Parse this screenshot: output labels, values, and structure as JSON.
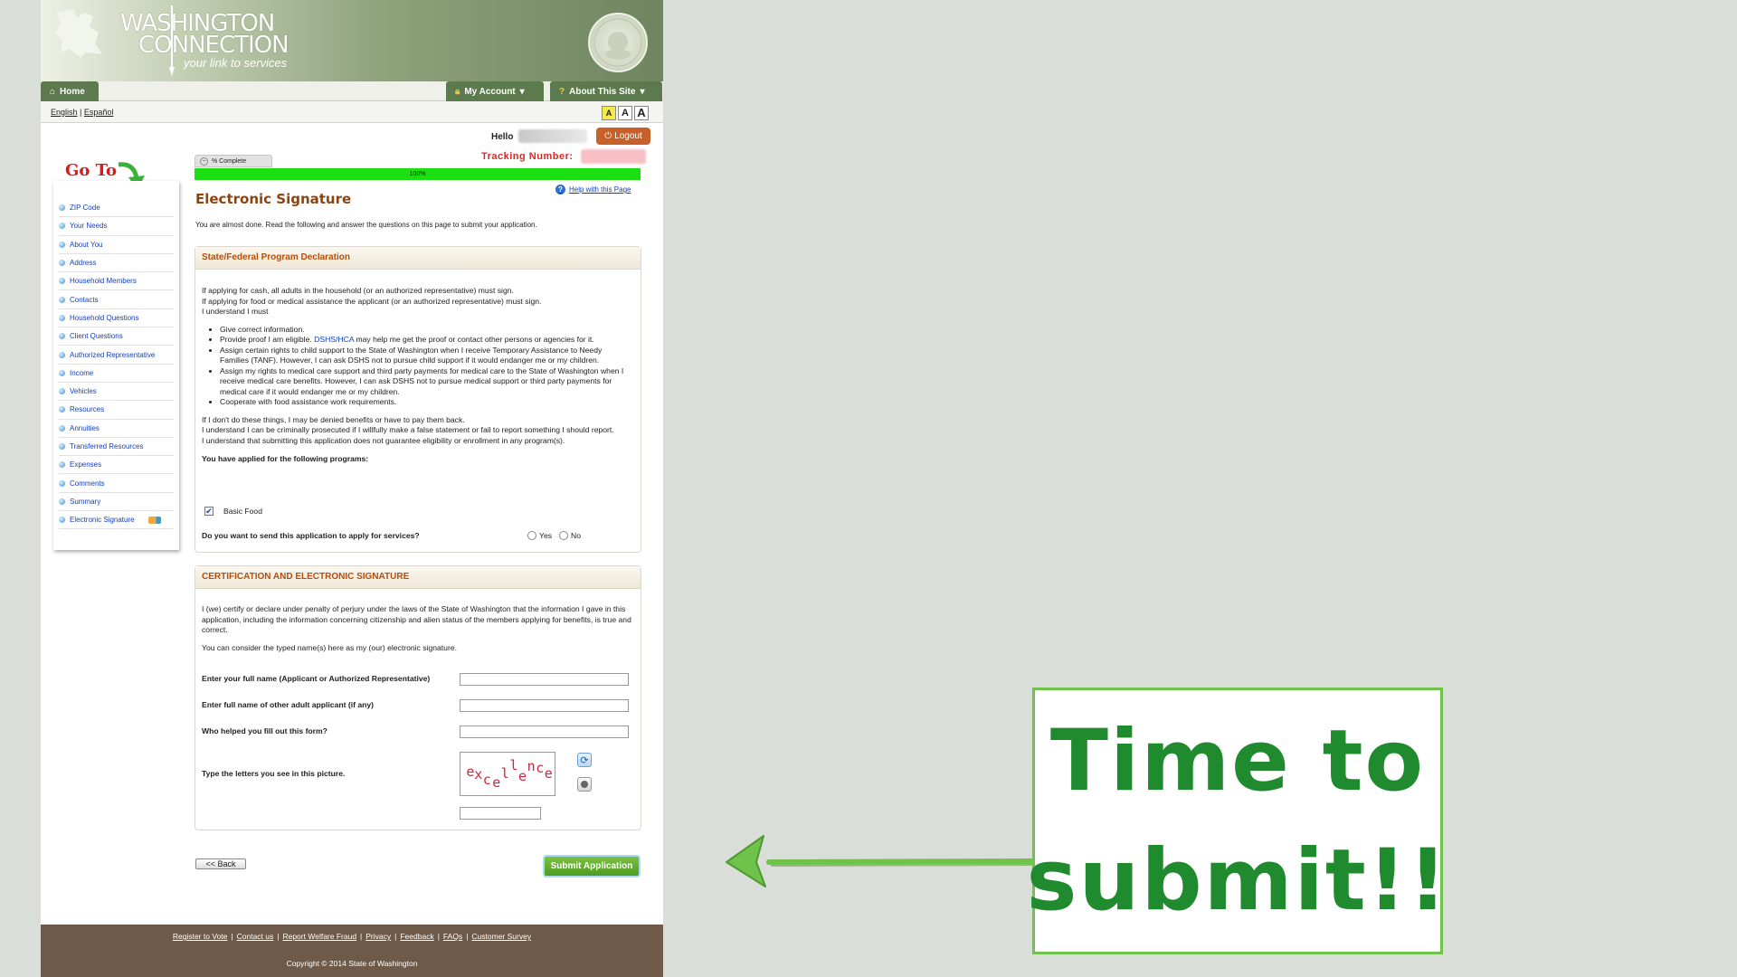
{
  "banner": {
    "logo_line1": "WASHINGTON",
    "logo_line2": "CONNECTION",
    "tagline": "your link to services"
  },
  "nav": {
    "home": "Home",
    "my_account": "My Account",
    "about": "About This Site"
  },
  "lang": {
    "english": "English",
    "espanol": "Español",
    "separator": "|",
    "font_sizes": [
      "A",
      "A",
      "A"
    ]
  },
  "user": {
    "hello": "Hello",
    "logout": "Logout",
    "tracking_label": "Tracking Number:"
  },
  "goto": "Go To",
  "sidebar": {
    "items": [
      {
        "label": "ZIP Code"
      },
      {
        "label": "Your Needs"
      },
      {
        "label": "About You"
      },
      {
        "label": "Address"
      },
      {
        "label": "Household Members"
      },
      {
        "label": "Contacts"
      },
      {
        "label": "Household Questions"
      },
      {
        "label": "Client Questions"
      },
      {
        "label": "Authorized Representative"
      },
      {
        "label": "Income"
      },
      {
        "label": "Vehicles"
      },
      {
        "label": "Resources"
      },
      {
        "label": "Annuities"
      },
      {
        "label": "Transferred Resources"
      },
      {
        "label": "Expenses"
      },
      {
        "label": "Comments"
      },
      {
        "label": "Summary"
      },
      {
        "label": "Electronic Signature"
      }
    ]
  },
  "progress": {
    "label": "% Complete",
    "value_text": "100%",
    "fraction": 1.0
  },
  "help_link": "Help with this Page",
  "page_title": "Electronic Signature",
  "intro": "You are almost done. Read the following and answer the questions on this page to submit your application.",
  "declaration": {
    "title": "State/Federal Program Declaration",
    "p1": "If applying for cash, all adults in the household (or an authorized representative) must sign.",
    "p2": "If applying for food or medical assistance the applicant (or an authorized representative) must sign.",
    "p3": "I understand I must",
    "b1": "Give correct information.",
    "b2a": "Provide proof I am eligible.",
    "b2_link": "DSHS/HCA",
    "b2b": "may help me get the proof or contact other persons or agencies for it.",
    "b3": "Assign certain rights to child support to the State of Washington when I receive Temporary Assistance to Needy Families (TANF). However, I can ask DSHS not to pursue child support if it would endanger me or my children.",
    "b4": "Assign my rights to medical care support and third party payments for medical care to the State of Washington when I receive medical care benefits. However, I can ask DSHS not to pursue medical support or third party payments for medical care if it would endanger me or my children.",
    "b5": "Cooperate with food assistance work requirements.",
    "p4": "If I don't do these things, I may be denied benefits or have to pay them back.",
    "p5": "I understand I can be criminally prosecuted if I willfully make a false statement or fail to report something I should report.",
    "p6": "I understand that submitting this application does not guarantee eligibility or enrollment in any program(s).",
    "programs_label": "You have applied for the following programs:",
    "program": "Basic Food",
    "check_mark": "✔",
    "send_question": "Do you want to send this application to apply for services?",
    "yes": "Yes",
    "no": "No"
  },
  "certification": {
    "title": "CERTIFICATION AND ELECTRONIC SIGNATURE",
    "p1": "I (we) certify or declare under penalty of perjury under the laws of the State of Washington that the information I gave in this application, including the information concerning citizenship and alien status of the members applying for benefits, is true and correct.",
    "p2": "You can consider the typed name(s) here as my (our) electronic signature.",
    "field1": "Enter your full name (Applicant or Authorized Representative)",
    "field2": "Enter full name of other adult applicant (if any)",
    "field3": "Who helped you fill out this form?",
    "captcha_label": "Type the letters you see in this picture.",
    "captcha_letters": [
      "e",
      "x",
      "c",
      "e",
      "l",
      "l",
      "e",
      "n",
      "c",
      "e"
    ]
  },
  "buttons": {
    "back": "<< Back",
    "submit": "Submit Application"
  },
  "footer": {
    "links": [
      "Register to Vote",
      "Contact us",
      "Report Welfare Fraud",
      "Privacy",
      "Feedback",
      "FAQs",
      "Customer Survey"
    ],
    "copyright": "Copyright © 2014 State of Washington"
  },
  "callout": {
    "line1": "Time to",
    "line2": "submit!!",
    "color": "#1f8a2e"
  },
  "colors": {
    "nav_green": "#5d7a4e",
    "progress_green": "#1bdf10",
    "title_brown": "#8b4513",
    "tracking_red": "#d62a2a",
    "submit_green": "#5fae2d",
    "footer_brown": "#6d5a49"
  }
}
